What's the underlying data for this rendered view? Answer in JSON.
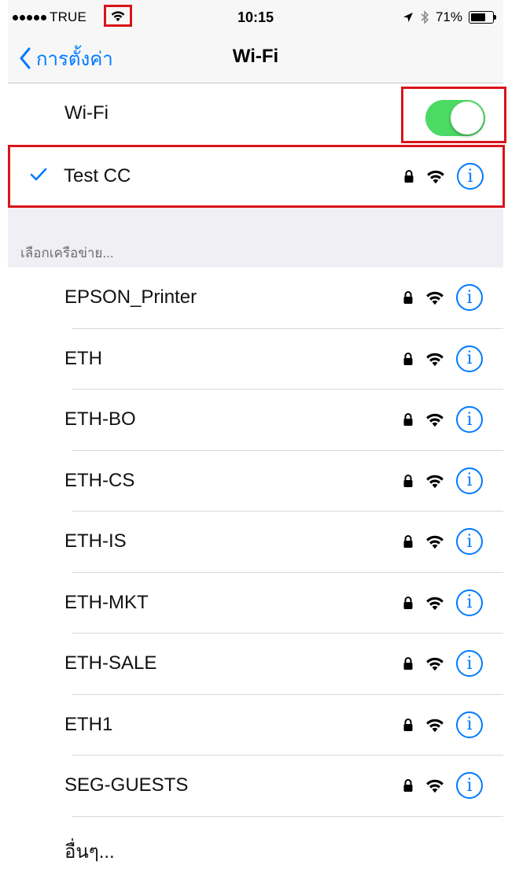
{
  "status_bar": {
    "carrier": "TRUE",
    "time": "10:15",
    "battery_percent": "71%",
    "battery_level": 0.71
  },
  "nav": {
    "back_label": "การตั้งค่า",
    "title": "Wi-Fi"
  },
  "wifi_toggle": {
    "label": "Wi-Fi",
    "enabled": true,
    "color": "#4cd964"
  },
  "connected": {
    "name": "Test CC"
  },
  "section_header": "เลือกเครือข่าย...",
  "networks": [
    {
      "name": "EPSON_Printer"
    },
    {
      "name": "ETH"
    },
    {
      "name": "ETH-BO"
    },
    {
      "name": "ETH-CS"
    },
    {
      "name": "ETH-IS"
    },
    {
      "name": "ETH-MKT"
    },
    {
      "name": "ETH-SALE"
    },
    {
      "name": "ETH1"
    },
    {
      "name": "SEG-GUESTS"
    }
  ],
  "other_label": "อื่นๆ...",
  "colors": {
    "accent": "#007aff",
    "highlight_box": "#d9141b",
    "toggle_on": "#4cd964",
    "grouped_bg": "#efeff4"
  },
  "icons": {
    "lock": "lock-icon",
    "wifi": "wifi-signal-icon",
    "info": "info-icon",
    "check": "checkmark-icon"
  }
}
